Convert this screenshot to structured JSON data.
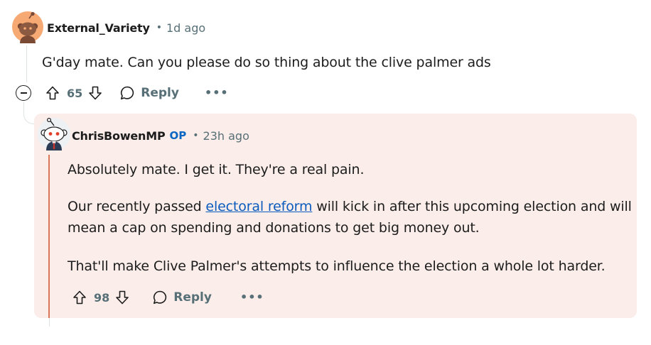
{
  "parent_comment": {
    "avatar_icon": "reddit-snoo-avatar-icon",
    "username": "External_Variety",
    "separator": "•",
    "timestamp": "1d ago",
    "body": "G'day mate. Can you please do so thing about the clive palmer ads",
    "vote_count": "65",
    "reply_label": "Reply",
    "more_label": "•••"
  },
  "reply_comment": {
    "avatar_icon": "reddit-snoo-avatar-icon",
    "username": "ChrisBowenMP",
    "op_badge": "OP",
    "separator": "•",
    "timestamp": "23h ago",
    "paragraph_1": "Absolutely mate. I get it. They're a real pain.",
    "paragraph_2_before": "Our recently passed ",
    "paragraph_2_link": "electoral reform",
    "paragraph_2_after": " will kick in after this upcoming election and will",
    "paragraph_2_line2": "mean a cap on spending and donations to get big money out.",
    "paragraph_3": "That'll make Clive Palmer's attempts to influence the election a whole lot harder.",
    "vote_count": "98",
    "reply_label": "Reply",
    "more_label": "•••"
  },
  "colors": {
    "highlight_background": "#fbeeea",
    "highlight_rule": "#d97758",
    "link": "#0a5bbd",
    "op_badge": "#0a66c2",
    "meta_text": "#576f76"
  }
}
